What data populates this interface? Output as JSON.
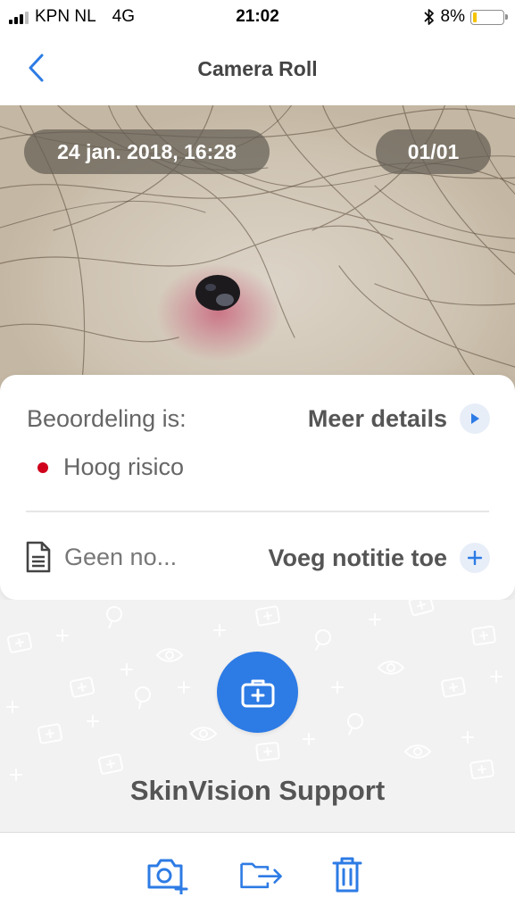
{
  "status_bar": {
    "carrier": "KPN NL",
    "network": "4G",
    "time": "21:02",
    "battery": "8%",
    "battery_level": 0.08,
    "signal_bars": 3
  },
  "nav": {
    "back_icon": "chevron-left-icon",
    "title": "Camera Roll"
  },
  "photo": {
    "date": "24 jan. 2018, 16:28",
    "counter": "01/01"
  },
  "assessment": {
    "label": "Beoordeling is:",
    "details_link": "Meer details",
    "risk": "Hoog risico",
    "risk_color": "#d0021b"
  },
  "notes": {
    "text": "Geen no...",
    "add_label": "Voeg notitie toe"
  },
  "support": {
    "label": "SkinVision Support",
    "icon": "medical-kit-icon"
  },
  "toolbar": {
    "icons": [
      "camera-add-icon",
      "folder-move-icon",
      "trash-icon"
    ]
  },
  "colors": {
    "accent": "#2d7be5",
    "risk_high": "#d0021b",
    "battery_low": "#f5c400"
  }
}
